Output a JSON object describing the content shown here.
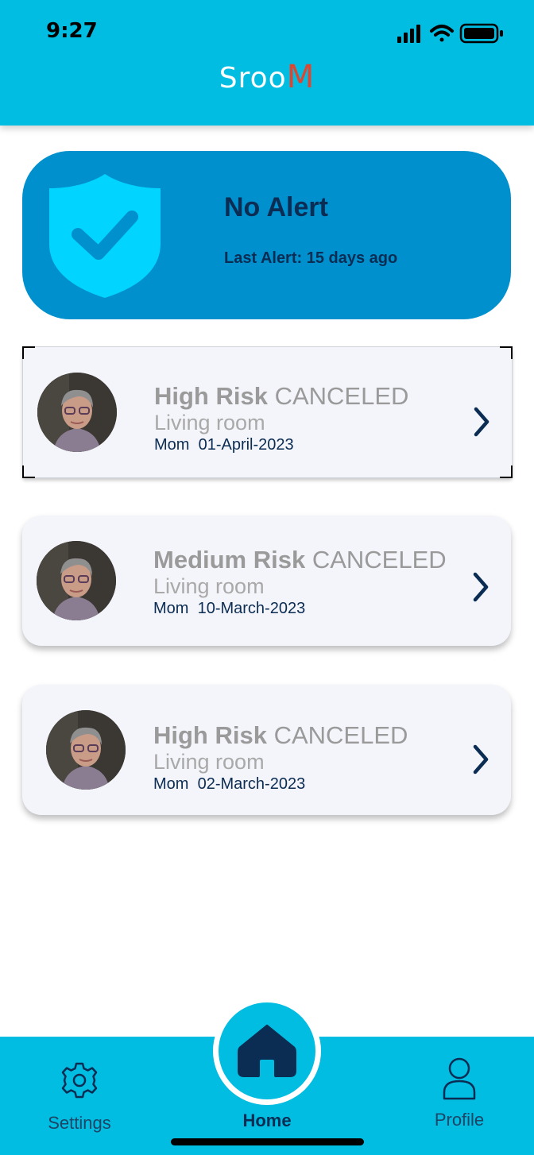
{
  "status_bar": {
    "time": "9:27"
  },
  "header": {
    "logo_main": "Sroo",
    "logo_accent": "M"
  },
  "alert": {
    "title": "No Alert",
    "subtitle": "Last Alert: 15 days ago",
    "icon": "shield-check-icon"
  },
  "events": [
    {
      "risk": "High Risk",
      "status": "CANCELED",
      "room": "Living room",
      "person": "Mom",
      "date": "01-April-2023"
    },
    {
      "risk": "Medium Risk",
      "status": "CANCELED",
      "room": "Living room",
      "person": "Mom",
      "date": "10-March-2023"
    },
    {
      "risk": "High Risk",
      "status": "CANCELED",
      "room": "Living room",
      "person": "Mom",
      "date": "02-March-2023"
    }
  ],
  "nav": {
    "settings": "Settings",
    "home": "Home",
    "profile": "Profile"
  },
  "colors": {
    "header_bg": "#00bde1",
    "alert_card_bg": "#0090cd",
    "shield": "#00d4ff",
    "text_dark": "#0b2c53",
    "logo_accent": "#e0452f"
  }
}
